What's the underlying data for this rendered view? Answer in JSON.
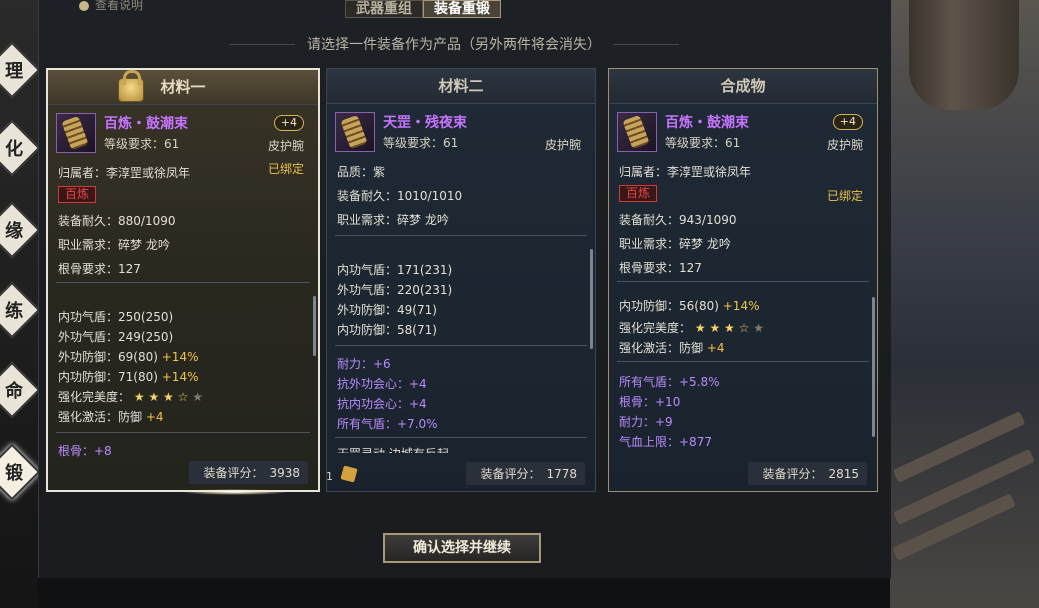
{
  "hint": "查看说明",
  "tabs": [
    "武器重组",
    "装备重锻"
  ],
  "subtitle": "请选择一件装备作为产品（另外两件将会消失）",
  "cards": [
    {
      "header": "材料一",
      "name": "百炼・鼓潮束",
      "req": "等级要求：61",
      "badge": "+4",
      "slot": "皮护腕",
      "owner": "归属者：李淳罡或徐凤年",
      "bound": "已绑定",
      "tag": "百炼",
      "durability": "装备耐久：880/1090",
      "class": "职业需求：碎梦  龙吟",
      "root": "根骨要求：127",
      "stats": [
        {
          "label": "内功气盾：250",
          "max": "(250)",
          "bonus": ""
        },
        {
          "label": "外功气盾：249",
          "max": "(250)",
          "bonus": ""
        },
        {
          "label": "外功防御：69",
          "max": "(80)",
          "bonus": "+14%"
        },
        {
          "label": "内功防御：71",
          "max": "(80)",
          "bonus": "+14%"
        }
      ],
      "perfect": "强化完美度：",
      "activate": "强化激活：防御",
      "activate_bonus": "+4",
      "extra": "根骨：+8",
      "score_label": "装备评分：",
      "score": "3938"
    },
    {
      "header": "材料二",
      "name": "天罡・残夜束",
      "req": "等级要求：61",
      "slot": "皮护腕",
      "quality": "品质：紫",
      "durability": "装备耐久：1010/1010",
      "class": "职业需求：碎梦  龙吟",
      "stats": [
        {
          "label": "内功气盾：171",
          "max": "(231)"
        },
        {
          "label": "外功气盾：220",
          "max": "(231)"
        },
        {
          "label": "外功防御：49",
          "max": "(71)"
        },
        {
          "label": "内功防御：58",
          "max": "(71)"
        }
      ],
      "purple_stats": [
        "耐力：+6",
        "抗外功会心：+4",
        "抗内功会心：+4",
        "所有气盾：+7.0%"
      ],
      "cut": "天罡灵动 边城有反起",
      "count": "1",
      "score_label": "装备评分：",
      "score": "1778"
    },
    {
      "header": "合成物",
      "name": "百炼・鼓潮束",
      "req": "等级要求：61",
      "badge": "+4",
      "slot": "皮护腕",
      "owner": "归属者：李淳罡或徐凤年",
      "bound": "已绑定",
      "tag": "百炼",
      "durability": "装备耐久：943/1090",
      "class": "职业需求：碎梦  龙吟",
      "root": "根骨要求：127",
      "stats": [
        {
          "label": "内功防御：56",
          "max": "(80)",
          "bonus": "+14%"
        }
      ],
      "perfect": "强化完美度：",
      "activate": "强化激活：防御",
      "activate_bonus": "+4",
      "purple_stats": [
        "所有气盾：+5.8%",
        "根骨：+10",
        "耐力：+9",
        "气血上限：+877"
      ],
      "score_label": "装备评分：",
      "score": "2815"
    }
  ],
  "stars": {
    "filled": 3,
    "total": 5
  },
  "confirm": "确认选择并继续",
  "side_tabs": [
    "理",
    "化",
    "缘",
    "练",
    "命",
    "锻"
  ]
}
